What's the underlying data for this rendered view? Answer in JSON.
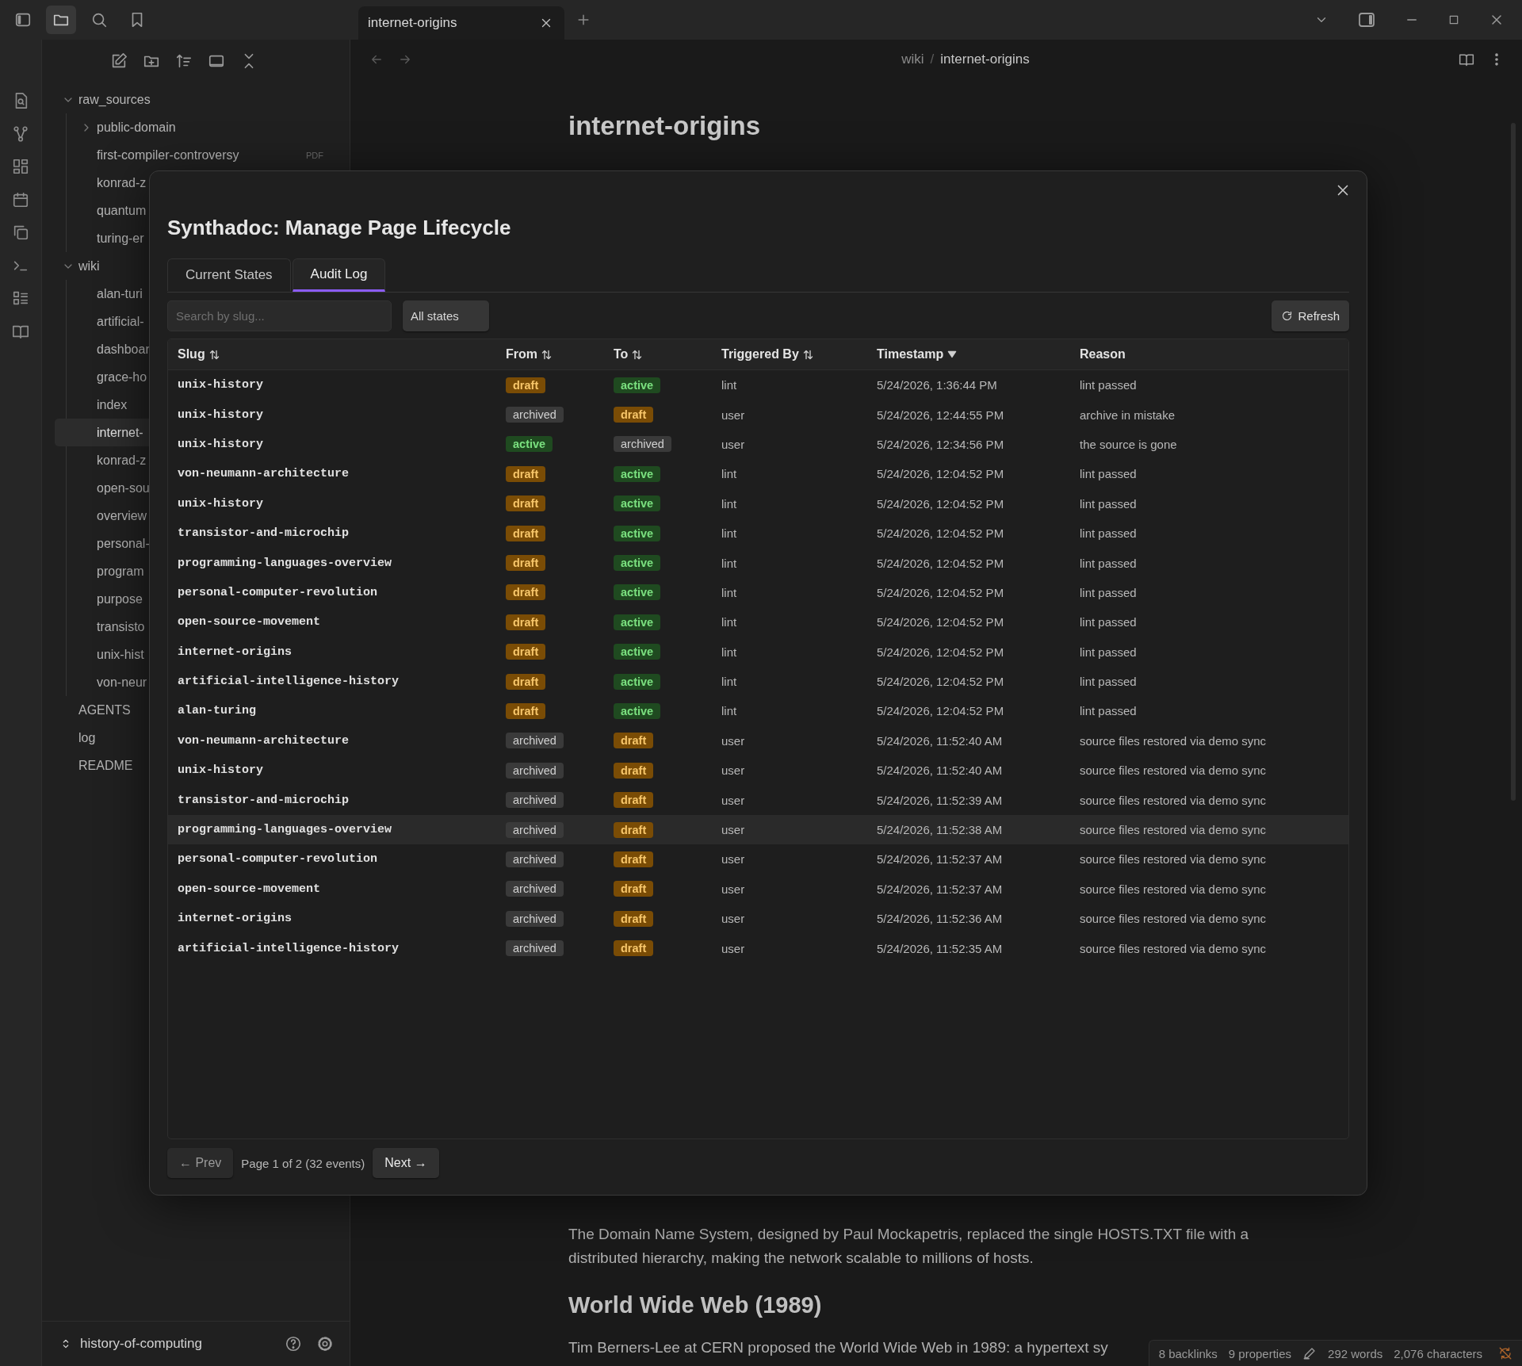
{
  "window": {
    "left_buttons": [
      {
        "selected": false
      },
      {
        "selected": true
      },
      {
        "selected": false
      },
      {
        "selected": false
      }
    ],
    "tab": {
      "title": "internet-origins"
    }
  },
  "sidebar": {
    "tree": [
      {
        "label": "raw_sources",
        "kind": "folder",
        "expanded": true,
        "selected": false,
        "children": [
          {
            "label": "public-domain",
            "kind": "folder",
            "expanded": false,
            "selected": false
          },
          {
            "label": "first-compiler-controversy",
            "kind": "file",
            "selected": false,
            "badge": "PDF"
          },
          {
            "label": "konrad-z",
            "kind": "file",
            "selected": false
          },
          {
            "label": "quantum",
            "kind": "file",
            "selected": false
          },
          {
            "label": "turing-er",
            "kind": "file",
            "selected": false
          }
        ]
      },
      {
        "label": "wiki",
        "kind": "folder",
        "expanded": true,
        "selected": false,
        "children": [
          {
            "label": "alan-turi",
            "kind": "file",
            "selected": false
          },
          {
            "label": "artificial-",
            "kind": "file",
            "selected": false
          },
          {
            "label": "dashboar",
            "kind": "file",
            "selected": false
          },
          {
            "label": "grace-ho",
            "kind": "file",
            "selected": false
          },
          {
            "label": "index",
            "kind": "file",
            "selected": false
          },
          {
            "label": "internet-",
            "kind": "file",
            "selected": true
          },
          {
            "label": "konrad-z",
            "kind": "file",
            "selected": false
          },
          {
            "label": "open-sou",
            "kind": "file",
            "selected": false
          },
          {
            "label": "overview",
            "kind": "file",
            "selected": false
          },
          {
            "label": "personal-",
            "kind": "file",
            "selected": false
          },
          {
            "label": "program",
            "kind": "file",
            "selected": false
          },
          {
            "label": "purpose",
            "kind": "file",
            "selected": false
          },
          {
            "label": "transisto",
            "kind": "file",
            "selected": false
          },
          {
            "label": "unix-hist",
            "kind": "file",
            "selected": false
          },
          {
            "label": "von-neur",
            "kind": "file",
            "selected": false
          }
        ]
      },
      {
        "label": "AGENTS",
        "kind": "file",
        "selected": false
      },
      {
        "label": "log",
        "kind": "file",
        "selected": false
      },
      {
        "label": "README",
        "kind": "file",
        "selected": false
      }
    ],
    "vault": "history-of-computing"
  },
  "editor": {
    "breadcrumb": {
      "parent": "wiki",
      "separator": "/",
      "current": "internet-origins"
    },
    "title": "internet-origins",
    "paragraph_1": "The Domain Name System, designed by Paul Mockapetris, replaced the single HOSTS.TXT file with a distributed hierarchy, making the network scalable to millions of hosts.",
    "heading_2": "World Wide Web (1989)",
    "paragraph_2": "Tim Berners-Lee at CERN proposed the World Wide Web in 1989: a hypertext sy"
  },
  "status_bar": {
    "backlinks": "8 backlinks",
    "properties": "9 properties",
    "words": "292 words",
    "characters": "2,076 characters"
  },
  "modal": {
    "title": "Synthadoc: Manage Page Lifecycle",
    "tabs": [
      {
        "label": "Current States",
        "selected": false
      },
      {
        "label": "Audit Log",
        "selected": true
      }
    ],
    "search": {
      "placeholder": "Search by slug..."
    },
    "filter": "All states",
    "refresh": "Refresh",
    "columns": [
      {
        "label": "Slug",
        "kind": "sortable"
      },
      {
        "label": "From",
        "kind": "sortable"
      },
      {
        "label": "To",
        "kind": "sortable"
      },
      {
        "label": "Triggered By",
        "kind": "sortable"
      },
      {
        "label": "Timestamp",
        "kind": "sorted"
      },
      {
        "label": "Reason",
        "kind": "plain"
      }
    ],
    "rows": [
      {
        "slug": "unix-history",
        "from": {
          "text": "draft",
          "kind": "draft"
        },
        "to": {
          "text": "active",
          "kind": "active"
        },
        "triggered_by": "lint",
        "timestamp": "5/24/2026, 1:36:44 PM",
        "reason": "lint passed",
        "selected": false
      },
      {
        "slug": "unix-history",
        "from": {
          "text": "archived",
          "kind": "archived"
        },
        "to": {
          "text": "draft",
          "kind": "draft"
        },
        "triggered_by": "user",
        "timestamp": "5/24/2026, 12:44:55 PM",
        "reason": "archive in mistake",
        "selected": false
      },
      {
        "slug": "unix-history",
        "from": {
          "text": "active",
          "kind": "active"
        },
        "to": {
          "text": "archived",
          "kind": "archived"
        },
        "triggered_by": "user",
        "timestamp": "5/24/2026, 12:34:56 PM",
        "reason": "the source is gone",
        "selected": false
      },
      {
        "slug": "von-neumann-architecture",
        "from": {
          "text": "draft",
          "kind": "draft"
        },
        "to": {
          "text": "active",
          "kind": "active"
        },
        "triggered_by": "lint",
        "timestamp": "5/24/2026, 12:04:52 PM",
        "reason": "lint passed",
        "selected": false
      },
      {
        "slug": "unix-history",
        "from": {
          "text": "draft",
          "kind": "draft"
        },
        "to": {
          "text": "active",
          "kind": "active"
        },
        "triggered_by": "lint",
        "timestamp": "5/24/2026, 12:04:52 PM",
        "reason": "lint passed",
        "selected": false
      },
      {
        "slug": "transistor-and-microchip",
        "from": {
          "text": "draft",
          "kind": "draft"
        },
        "to": {
          "text": "active",
          "kind": "active"
        },
        "triggered_by": "lint",
        "timestamp": "5/24/2026, 12:04:52 PM",
        "reason": "lint passed",
        "selected": false
      },
      {
        "slug": "programming-languages-overview",
        "from": {
          "text": "draft",
          "kind": "draft"
        },
        "to": {
          "text": "active",
          "kind": "active"
        },
        "triggered_by": "lint",
        "timestamp": "5/24/2026, 12:04:52 PM",
        "reason": "lint passed",
        "selected": false
      },
      {
        "slug": "personal-computer-revolution",
        "from": {
          "text": "draft",
          "kind": "draft"
        },
        "to": {
          "text": "active",
          "kind": "active"
        },
        "triggered_by": "lint",
        "timestamp": "5/24/2026, 12:04:52 PM",
        "reason": "lint passed",
        "selected": false
      },
      {
        "slug": "open-source-movement",
        "from": {
          "text": "draft",
          "kind": "draft"
        },
        "to": {
          "text": "active",
          "kind": "active"
        },
        "triggered_by": "lint",
        "timestamp": "5/24/2026, 12:04:52 PM",
        "reason": "lint passed",
        "selected": false
      },
      {
        "slug": "internet-origins",
        "from": {
          "text": "draft",
          "kind": "draft"
        },
        "to": {
          "text": "active",
          "kind": "active"
        },
        "triggered_by": "lint",
        "timestamp": "5/24/2026, 12:04:52 PM",
        "reason": "lint passed",
        "selected": false
      },
      {
        "slug": "artificial-intelligence-history",
        "from": {
          "text": "draft",
          "kind": "draft"
        },
        "to": {
          "text": "active",
          "kind": "active"
        },
        "triggered_by": "lint",
        "timestamp": "5/24/2026, 12:04:52 PM",
        "reason": "lint passed",
        "selected": false
      },
      {
        "slug": "alan-turing",
        "from": {
          "text": "draft",
          "kind": "draft"
        },
        "to": {
          "text": "active",
          "kind": "active"
        },
        "triggered_by": "lint",
        "timestamp": "5/24/2026, 12:04:52 PM",
        "reason": "lint passed",
        "selected": false
      },
      {
        "slug": "von-neumann-architecture",
        "from": {
          "text": "archived",
          "kind": "archived"
        },
        "to": {
          "text": "draft",
          "kind": "draft"
        },
        "triggered_by": "user",
        "timestamp": "5/24/2026, 11:52:40 AM",
        "reason": "source files restored via demo sync",
        "selected": false
      },
      {
        "slug": "unix-history",
        "from": {
          "text": "archived",
          "kind": "archived"
        },
        "to": {
          "text": "draft",
          "kind": "draft"
        },
        "triggered_by": "user",
        "timestamp": "5/24/2026, 11:52:40 AM",
        "reason": "source files restored via demo sync",
        "selected": false
      },
      {
        "slug": "transistor-and-microchip",
        "from": {
          "text": "archived",
          "kind": "archived"
        },
        "to": {
          "text": "draft",
          "kind": "draft"
        },
        "triggered_by": "user",
        "timestamp": "5/24/2026, 11:52:39 AM",
        "reason": "source files restored via demo sync",
        "selected": false
      },
      {
        "slug": "programming-languages-overview",
        "from": {
          "text": "archived",
          "kind": "archived"
        },
        "to": {
          "text": "draft",
          "kind": "draft"
        },
        "triggered_by": "user",
        "timestamp": "5/24/2026, 11:52:38 AM",
        "reason": "source files restored via demo sync",
        "selected": true
      },
      {
        "slug": "personal-computer-revolution",
        "from": {
          "text": "archived",
          "kind": "archived"
        },
        "to": {
          "text": "draft",
          "kind": "draft"
        },
        "triggered_by": "user",
        "timestamp": "5/24/2026, 11:52:37 AM",
        "reason": "source files restored via demo sync",
        "selected": false
      },
      {
        "slug": "open-source-movement",
        "from": {
          "text": "archived",
          "kind": "archived"
        },
        "to": {
          "text": "draft",
          "kind": "draft"
        },
        "triggered_by": "user",
        "timestamp": "5/24/2026, 11:52:37 AM",
        "reason": "source files restored via demo sync",
        "selected": false
      },
      {
        "slug": "internet-origins",
        "from": {
          "text": "archived",
          "kind": "archived"
        },
        "to": {
          "text": "draft",
          "kind": "draft"
        },
        "triggered_by": "user",
        "timestamp": "5/24/2026, 11:52:36 AM",
        "reason": "source files restored via demo sync",
        "selected": false
      },
      {
        "slug": "artificial-intelligence-history",
        "from": {
          "text": "archived",
          "kind": "archived"
        },
        "to": {
          "text": "draft",
          "kind": "draft"
        },
        "triggered_by": "user",
        "timestamp": "5/24/2026, 11:52:35 AM",
        "reason": "source files restored via demo sync",
        "selected": false
      }
    ],
    "pagination": {
      "prev": "← Prev",
      "info": "Page 1 of 2 (32 events)",
      "next": "Next →"
    }
  }
}
